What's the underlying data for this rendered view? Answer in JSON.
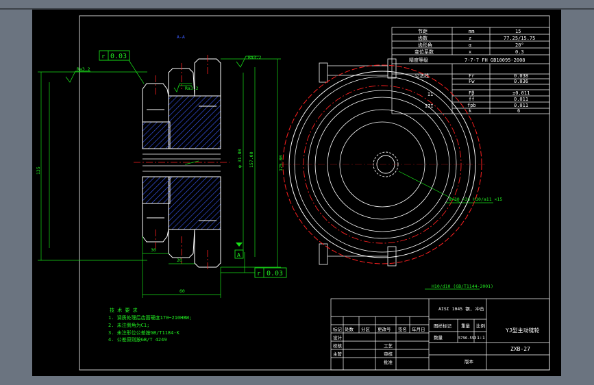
{
  "colors": {
    "background_outer": "#6b7480",
    "canvas": "#000000",
    "line_white": "#ffffff",
    "line_red": "#ff2020",
    "hatch_blue": "#2f4bd6",
    "dim_green": "#18e018",
    "text_green": "#22ee22",
    "border_gray": "#c8c8c8"
  },
  "drawing": {
    "title": "YJ型主动链轮",
    "drawing_number": "ZXB-27",
    "material": "AISI 1045 钢, 冲击",
    "scale": "1:1",
    "weight": "5796.553",
    "sheet_label": "图样标记",
    "weight_label": "重量",
    "scale_label": "比例",
    "quantity_label": "数量",
    "version_label": "版本"
  },
  "title_block": {
    "rev_headers": [
      "标记",
      "处数",
      "分区",
      "更改号",
      "签名",
      "年月日"
    ],
    "roles": [
      "设计",
      "校核",
      "主管"
    ],
    "roles2": [
      "工艺",
      "审核",
      "批准"
    ]
  },
  "tolerances": {
    "runout_left": "0.03",
    "runout_bottom": "0.03",
    "runout_symbol": "↗",
    "datum": "A",
    "roughness_1": "Ra3.2",
    "roughness_2": "Ra3.2",
    "roughness_3": "Ra3.2"
  },
  "dimensions": {
    "height_overall": "175.00",
    "pitch_dia": "157.00",
    "hub_dia": "φ 31.80",
    "left_dia": "135",
    "small_1": "30",
    "small_2": "20",
    "width_total": "60",
    "note_a": "A-A",
    "spline_spec": "8×30 ×36 H10/a11 ×15",
    "spline_spec_2": "H10/d10 (GB/T1144-2001)"
  },
  "param_table": [
    [
      "节距",
      "mm",
      "15"
    ],
    [
      "齿数",
      "z",
      "77.25/15.75"
    ],
    [
      "齿形角",
      "α",
      "20°"
    ],
    [
      "变位系数",
      "x",
      "0.3"
    ],
    [
      "精度等级",
      "",
      "7-7-7 FH GB10095-2008"
    ]
  ],
  "param_table_2": [
    [
      "公法线",
      "Fr",
      "0.038"
    ],
    [
      "",
      "Fw",
      "0.036"
    ],
    [
      "II",
      "Fβ",
      "±0.011"
    ],
    [
      "",
      "ff",
      "0.011"
    ],
    [
      "III",
      "fpb",
      "0.011"
    ],
    [
      "",
      "k",
      "6"
    ]
  ],
  "tech_notes": {
    "heading": "技 术 要 求",
    "items": [
      "1. 调质处理后齿面硬度170~210HBW;",
      "2. 未注倒角为C1;",
      "3. 未注形位公差按GB/T1184-K",
      "4. 公差原则按GB/T 4249"
    ]
  }
}
